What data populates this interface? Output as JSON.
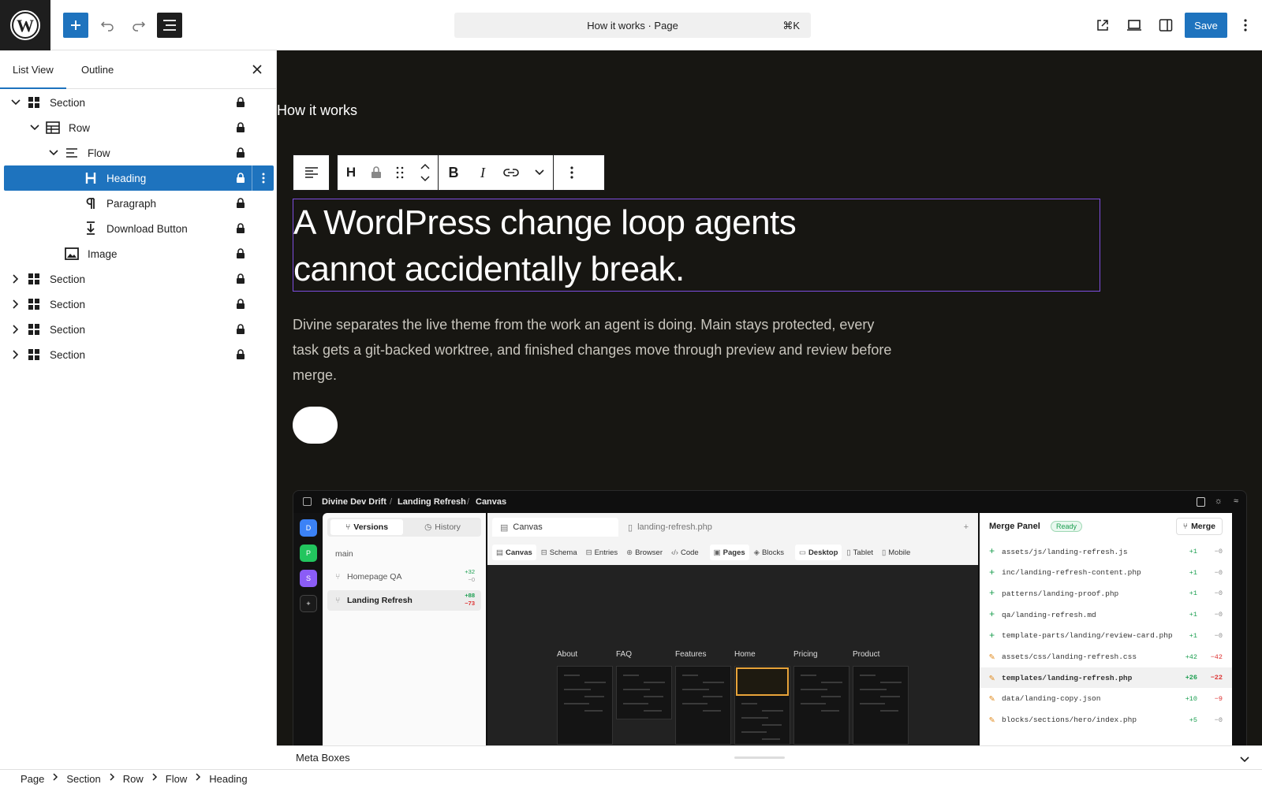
{
  "header": {
    "doc_title": "How it works · Page",
    "shortcut": "⌘K",
    "save_label": "Save"
  },
  "sidebar": {
    "tabs": [
      "List View",
      "Outline"
    ],
    "tree": [
      {
        "label": "Section",
        "icon": "grid-icon",
        "chevron": "down"
      },
      {
        "label": "Row",
        "icon": "row-icon",
        "chevron": "down"
      },
      {
        "label": "Flow",
        "icon": "stack-icon",
        "chevron": "down"
      },
      {
        "label": "Heading",
        "icon": "heading-icon",
        "chevron": "none",
        "selected": true
      },
      {
        "label": "Paragraph",
        "icon": "paragraph-icon",
        "chevron": "none"
      },
      {
        "label": "Download Button",
        "icon": "download-icon",
        "chevron": "none"
      },
      {
        "label": "Image",
        "icon": "image-icon",
        "chevron": "none"
      },
      {
        "label": "Section",
        "icon": "grid-icon",
        "chevron": "right"
      },
      {
        "label": "Section",
        "icon": "grid-icon",
        "chevron": "right"
      },
      {
        "label": "Section",
        "icon": "grid-icon",
        "chevron": "right"
      },
      {
        "label": "Section",
        "icon": "grid-icon",
        "chevron": "right"
      }
    ]
  },
  "canvas": {
    "page_label": "How it works",
    "heading_line1": "A WordPress change loop agents",
    "heading_line2": "cannot accidentally break.",
    "paragraph": "Divine separates the live theme from the work an agent is doing. Main stays protected, every task gets a git-backed worktree, and finished changes move through preview and review before merge."
  },
  "app_shot": {
    "breadcrumb": [
      "Divine Dev Drift",
      "Landing Refresh",
      "Canvas"
    ],
    "rail": [
      "D",
      "P",
      "S"
    ],
    "left_tabs": [
      "Versions",
      "History"
    ],
    "branch_main": "main",
    "branches": [
      {
        "name": "Homepage QA",
        "adds": "+32",
        "dels": "−0"
      },
      {
        "name": "Landing Refresh",
        "adds": "+88",
        "dels": "−73"
      }
    ],
    "center_tabs": [
      "Canvas",
      "landing-refresh.php"
    ],
    "tools": [
      "Canvas",
      "Schema",
      "Entries",
      "Browser",
      "Code",
      "Pages",
      "Blocks",
      "Desktop",
      "Tablet",
      "Mobile"
    ],
    "thumbs": [
      "About",
      "FAQ",
      "Features",
      "Home",
      "Pricing",
      "Product"
    ],
    "merge_title": "Merge Panel",
    "merge_status": "Ready",
    "merge_button": "Merge",
    "files": [
      {
        "icon": "+",
        "name": "assets/js/landing-refresh.js",
        "adds": "+1",
        "dels": "−0"
      },
      {
        "icon": "+",
        "name": "inc/landing-refresh-content.php",
        "adds": "+1",
        "dels": "−0"
      },
      {
        "icon": "+",
        "name": "patterns/landing-proof.php",
        "adds": "+1",
        "dels": "−0"
      },
      {
        "icon": "+",
        "name": "qa/landing-refresh.md",
        "adds": "+1",
        "dels": "−0"
      },
      {
        "icon": "+",
        "name": "template-parts/landing/review-card.php",
        "adds": "+1",
        "dels": "−0"
      },
      {
        "icon": "✎",
        "name": "assets/css/landing-refresh.css",
        "adds": "+42",
        "dels": "−42"
      },
      {
        "icon": "✎",
        "name": "templates/landing-refresh.php",
        "adds": "+26",
        "dels": "−22"
      },
      {
        "icon": "✎",
        "name": "data/landing-copy.json",
        "adds": "+10",
        "dels": "−9"
      },
      {
        "icon": "✎",
        "name": "blocks/sections/hero/index.php",
        "adds": "+5",
        "dels": "−0"
      }
    ]
  },
  "metabox": {
    "label": "Meta Boxes"
  },
  "footer": {
    "breadcrumbs": [
      "Page",
      "Section",
      "Row",
      "Flow",
      "Heading"
    ]
  },
  "colors": {
    "accent": "#1e73be",
    "canvas_bg": "#171612",
    "selection_outline": "#7e4ee0"
  }
}
